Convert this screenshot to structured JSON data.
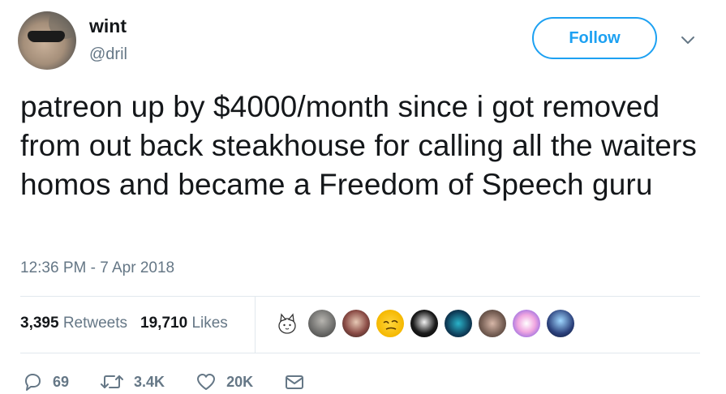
{
  "author": {
    "display_name": "wint",
    "handle": "@dril",
    "avatar": "avatar-sunglasses-man"
  },
  "follow_button": {
    "label": "Follow",
    "color": "#1da1f2"
  },
  "menu": {
    "icon": "chevron-down-icon"
  },
  "tweet": {
    "text": "patreon up by $4000/month since i got removed from out back steakhouse for calling all the waiters homos and became a Freedom of Speech guru",
    "timestamp": "12:36 PM - 7 Apr 2018"
  },
  "stats": {
    "retweets_count": "3,395",
    "retweets_label": "Retweets",
    "likes_count": "19,710",
    "likes_label": "Likes"
  },
  "likers": [
    "cat-cartoon-avatar",
    "grey-portrait-avatar",
    "woman-portrait-avatar",
    "emoji-face-avatar",
    "anime-black-avatar",
    "teal-mask-avatar",
    "blonde-portrait-avatar",
    "pastel-art-avatar",
    "anime-blue-avatar"
  ],
  "actions": {
    "reply": {
      "icon": "reply-icon",
      "count": "69"
    },
    "retweet": {
      "icon": "retweet-icon",
      "count": "3.4K"
    },
    "like": {
      "icon": "heart-icon",
      "count": "20K"
    },
    "dm": {
      "icon": "envelope-icon"
    }
  },
  "colors": {
    "text": "#14171a",
    "secondary": "#657786",
    "border": "#e1e8ed",
    "accent": "#1da1f2"
  }
}
